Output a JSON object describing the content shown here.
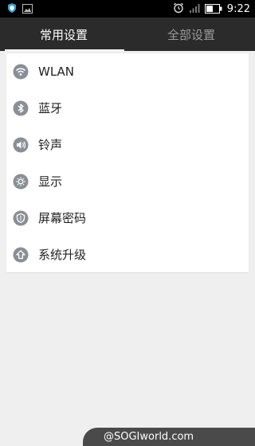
{
  "statusbar": {
    "time": "9:22"
  },
  "tabs": [
    {
      "label": "常用设置",
      "active": true
    },
    {
      "label": "全部设置",
      "active": false
    }
  ],
  "settings": {
    "items": [
      {
        "label": "WLAN",
        "icon": "wifi-icon"
      },
      {
        "label": "蓝牙",
        "icon": "bluetooth-icon"
      },
      {
        "label": "铃声",
        "icon": "speaker-icon"
      },
      {
        "label": "显示",
        "icon": "brightness-icon"
      },
      {
        "label": "屏幕密码",
        "icon": "shield-icon"
      },
      {
        "label": "系统升级",
        "icon": "upgrade-arrow-icon"
      }
    ]
  },
  "watermark": {
    "text": "@SOGIworld.com"
  },
  "colors": {
    "statusbar_bg": "#000000",
    "tabbar_bg": "#2b2b2b",
    "page_bg": "#efefef",
    "icon_gray": "#8a8f96"
  }
}
